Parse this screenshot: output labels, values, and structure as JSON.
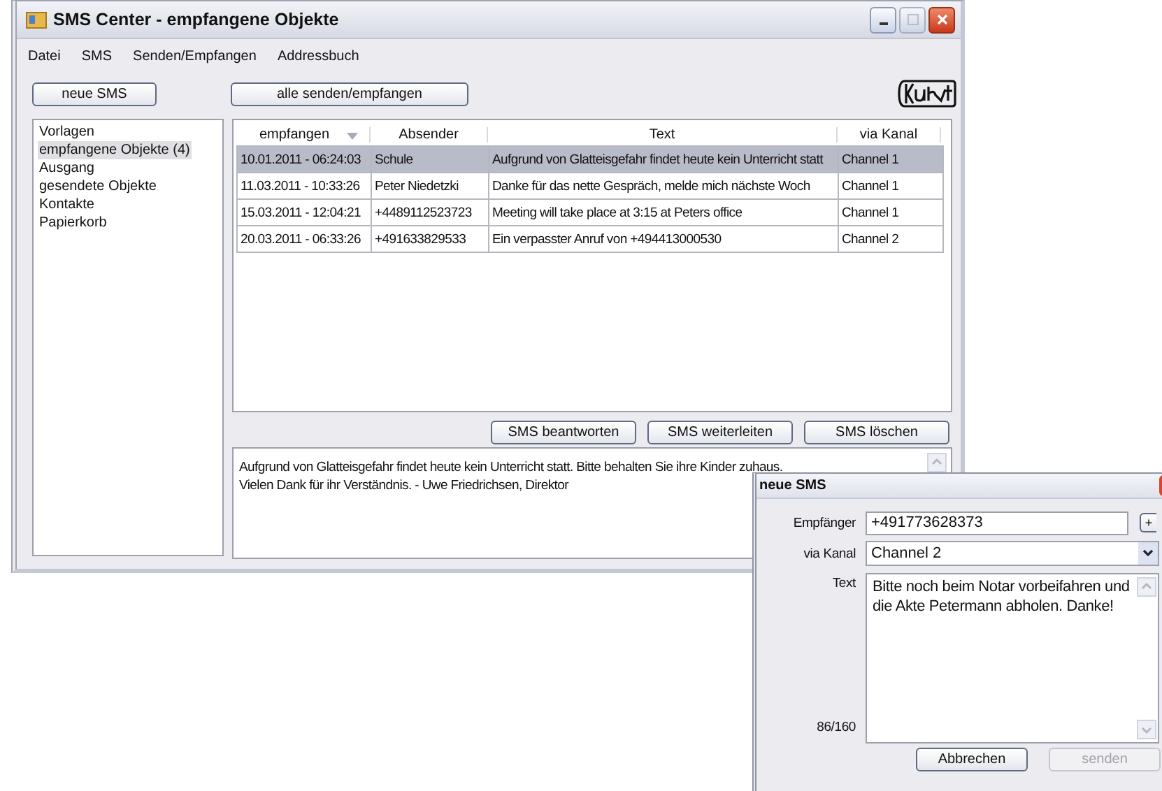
{
  "window": {
    "title": "SMS Center - empfangene Objekte"
  },
  "menu": [
    "Datei",
    "SMS",
    "Senden/Empfangen",
    "Addressbuch"
  ],
  "toolbar": {
    "new_button": "neue SMS",
    "sync_button": "alle senden/empfangen"
  },
  "folders": [
    {
      "label": "Vorlagen",
      "selected": false
    },
    {
      "label": "empfangene Objekte (4)",
      "selected": true
    },
    {
      "label": "Ausgang",
      "selected": false
    },
    {
      "label": "gesendete Objekte",
      "selected": false
    },
    {
      "label": "Kontakte",
      "selected": false
    },
    {
      "label": "Papierkorb",
      "selected": false
    }
  ],
  "table": {
    "columns": [
      {
        "label": "empfangen",
        "sorted": true
      },
      {
        "label": "Absender",
        "sorted": false
      },
      {
        "label": "Text",
        "sorted": false
      },
      {
        "label": "via Kanal",
        "sorted": false
      }
    ],
    "rows": [
      {
        "cells": [
          "10.01.2011 - 06:24:03",
          "Schule",
          "Aufgrund von Glatteisgefahr findet heute kein Unterricht statt",
          "Channel 1"
        ],
        "selected": true
      },
      {
        "cells": [
          "11.03.2011 - 10:33:26",
          "Peter Niedetzki",
          "Danke für das nette Gespräch, melde mich nächste Woch",
          "Channel 1"
        ],
        "selected": false
      },
      {
        "cells": [
          "15.03.2011 - 12:04:21",
          "+4489112523723",
          "Meeting will take place at 3:15 at Peters office",
          "Channel 1"
        ],
        "selected": false
      },
      {
        "cells": [
          "20.03.2011 - 06:33:26",
          "+491633829533",
          "Ein verpasster Anruf von +494413000530",
          "Channel 2"
        ],
        "selected": false
      }
    ]
  },
  "actions": [
    "SMS beantworten",
    "SMS weiterleiten",
    "SMS löschen"
  ],
  "preview": {
    "lines": [
      "Aufgrund von Glatteisgefahr findet heute kein Unterricht statt. Bitte behalten Sie ihre Kinder zuhaus.",
      "Vielen Dank für ihr Verständnis. - Uwe Friedrichsen, Direktor"
    ]
  },
  "dialog": {
    "title": "neue SMS",
    "recipient_label": "Empfänger",
    "recipient": "+491773628373",
    "add_button": "+",
    "channel_label": "via Kanal",
    "channel": "Channel 2",
    "text_label": "Text",
    "text": "Bitte noch beim Notar vorbeifahren und die Akte Petermann abholen. Danke!",
    "counter": "86/160",
    "buttons": [
      {
        "label": "Abbrechen",
        "disabled": false
      },
      {
        "label": "senden",
        "disabled": true
      }
    ]
  }
}
